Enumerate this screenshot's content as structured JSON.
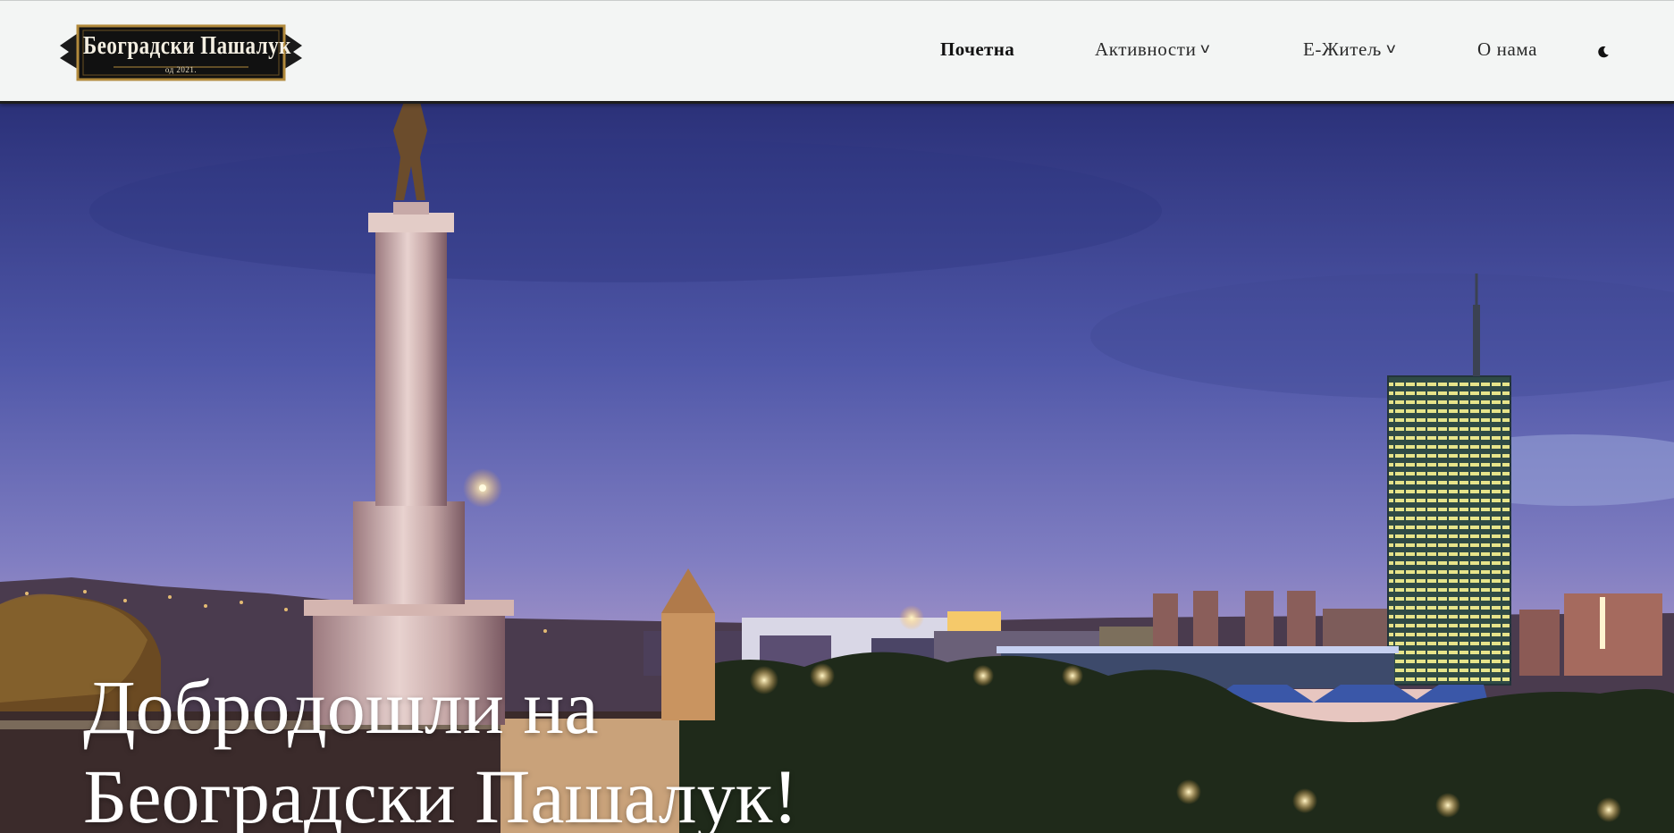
{
  "logo": {
    "title": "Београдски Пашалук",
    "subtitle": "од 2021."
  },
  "nav": {
    "items": [
      {
        "label": "Почетна",
        "active": true,
        "has_dropdown": false
      },
      {
        "label": "Активности",
        "active": false,
        "has_dropdown": true
      },
      {
        "label": "Е-Житељ",
        "active": false,
        "has_dropdown": true
      },
      {
        "label": "О нама",
        "active": false,
        "has_dropdown": false
      }
    ],
    "dropdown_glyph": "v",
    "theme_toggle_icon": "moon-icon"
  },
  "hero": {
    "title_line1": "Добродошли на",
    "title_line2": "Београдски Пашалук!"
  },
  "colors": {
    "header_bg": "#f3f5f4",
    "header_border": "#1d1d1d",
    "hero_title": "#ffffff",
    "sky_top": "#2c347a",
    "sky_bottom": "#8a86c8"
  }
}
